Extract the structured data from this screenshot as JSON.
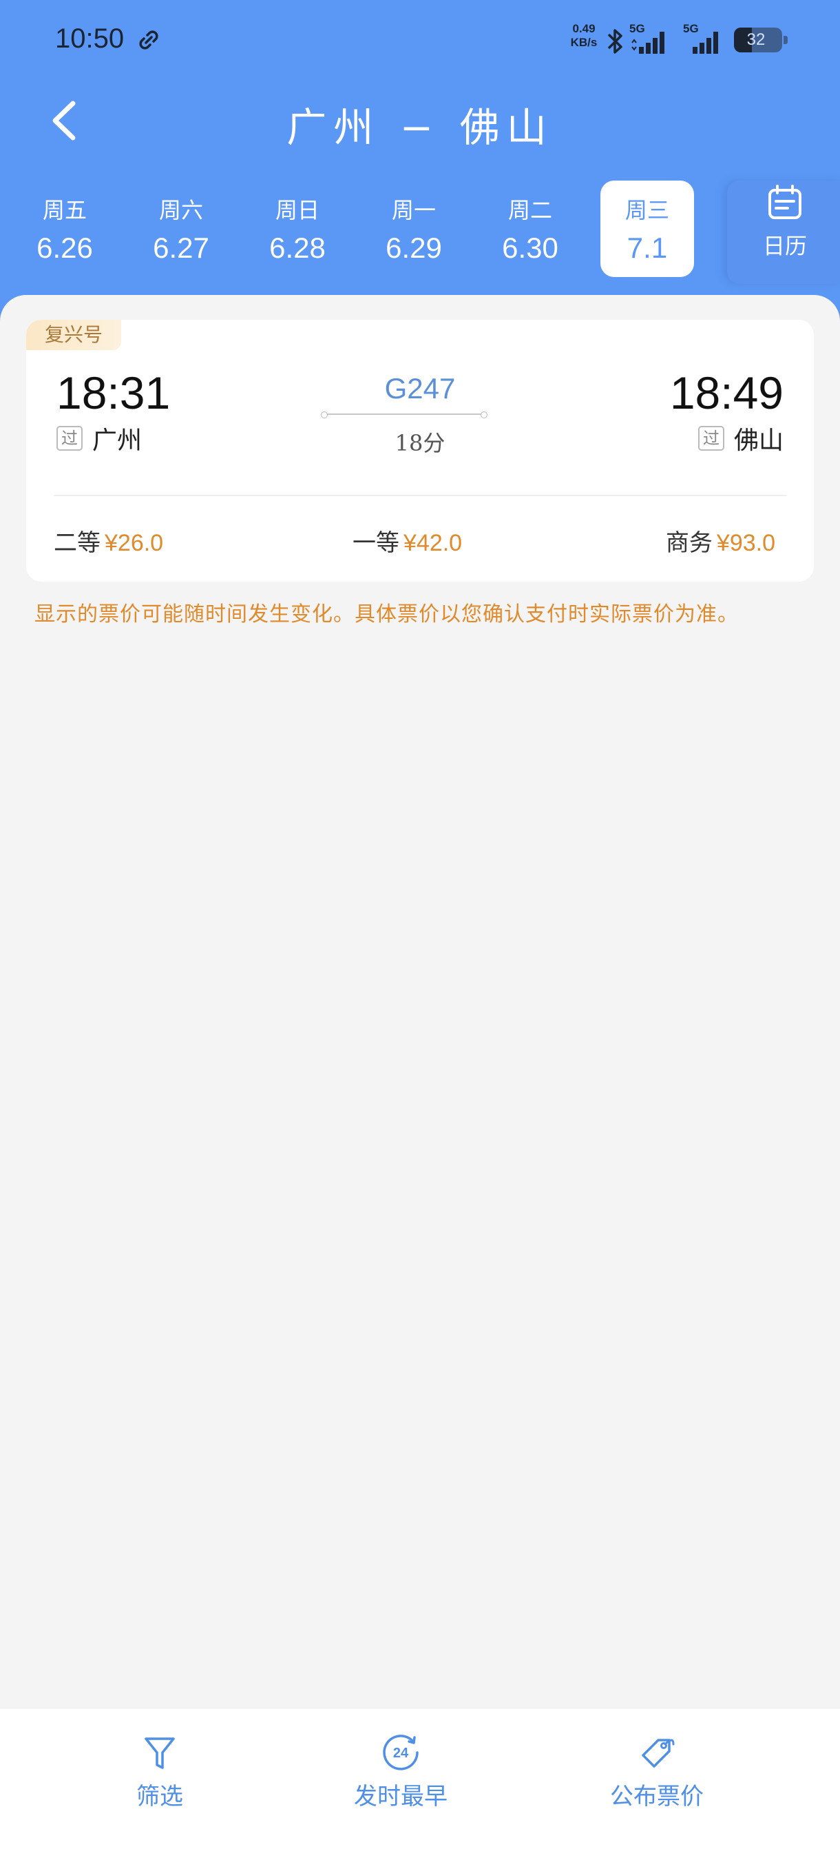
{
  "status_bar": {
    "time": "10:50",
    "net_speed_value": "0.49",
    "net_speed_unit": "KB/s",
    "signal1_label": "5G",
    "signal2_label": "5G",
    "battery": "32"
  },
  "nav": {
    "title": "广州 − 佛山"
  },
  "dates": [
    {
      "weekday": "周五",
      "date": "6.26"
    },
    {
      "weekday": "周六",
      "date": "6.27"
    },
    {
      "weekday": "周日",
      "date": "6.28"
    },
    {
      "weekday": "周一",
      "date": "6.29"
    },
    {
      "weekday": "周二",
      "date": "6.30"
    },
    {
      "weekday": "周三",
      "date": "7.1"
    }
  ],
  "selected_date_index": 5,
  "calendar_label": "日历",
  "train": {
    "type": "复兴号",
    "number": "G247",
    "depart_time": "18:31",
    "arrive_time": "18:49",
    "duration": "18分",
    "depart_tag": "过",
    "arrive_tag": "过",
    "depart_station": "广州",
    "arrive_station": "佛山",
    "seats": [
      {
        "class": "二等",
        "price": "¥26.0"
      },
      {
        "class": "一等",
        "price": "¥42.0"
      },
      {
        "class": "商务",
        "price": "¥93.0"
      }
    ]
  },
  "notice": "显示的票价可能随时间发生变化。具体票价以您确认支付时实际票价为准。",
  "bottom_bar": {
    "filter": "筛选",
    "earliest": "发时最早",
    "earliest_icon_text": "24",
    "fare": "公布票价"
  },
  "colors": {
    "header_blue": "#5b98f5",
    "price_orange": "#e08a2c",
    "train_no_blue": "#5b8fd8"
  },
  "icons": [
    "link-icon",
    "bluetooth-icon",
    "signal-icon",
    "battery-icon",
    "back-arrow-icon",
    "calendar-icon",
    "filter-icon",
    "clock-24-icon",
    "price-tag-icon"
  ]
}
